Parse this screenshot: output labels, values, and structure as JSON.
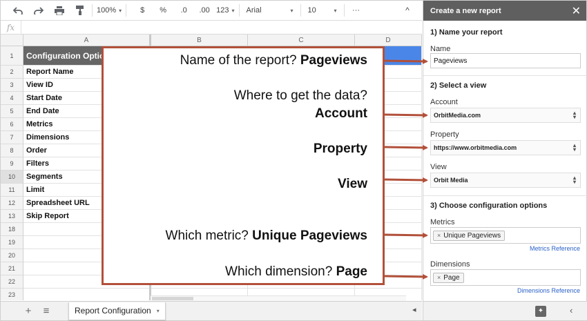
{
  "toolbar": {
    "undo_icon": "undo-icon",
    "redo_icon": "redo-icon",
    "print_icon": "print-icon",
    "paint_format_icon": "paint-format-icon",
    "zoom": "100%",
    "currency": "$",
    "percent": "%",
    "decrease_decimals": ".0",
    "increase_decimals": ".00",
    "more_formats": "123",
    "font": "Arial",
    "font_size": "10",
    "more": "···",
    "collapse": "^"
  },
  "formula_bar": {
    "fx": "fx",
    "value": ""
  },
  "grid": {
    "columns": [
      "A",
      "B",
      "C",
      "D"
    ],
    "rows": [
      {
        "num": "1",
        "a": "Configuration Options"
      },
      {
        "num": "2",
        "a": "Report Name"
      },
      {
        "num": "3",
        "a": "View ID"
      },
      {
        "num": "4",
        "a": "Start Date"
      },
      {
        "num": "5",
        "a": "End Date"
      },
      {
        "num": "6",
        "a": "Metrics"
      },
      {
        "num": "7",
        "a": "Dimensions"
      },
      {
        "num": "8",
        "a": "Order"
      },
      {
        "num": "9",
        "a": "Filters"
      },
      {
        "num": "10",
        "a": "Segments"
      },
      {
        "num": "11",
        "a": "Limit"
      },
      {
        "num": "12",
        "a": "Spreadsheet URL"
      },
      {
        "num": "13",
        "a": "Skip Report"
      },
      {
        "num": "18",
        "a": ""
      },
      {
        "num": "19",
        "a": ""
      },
      {
        "num": "20",
        "a": ""
      },
      {
        "num": "21",
        "a": ""
      },
      {
        "num": "22",
        "a": ""
      },
      {
        "num": "23",
        "a": ""
      }
    ]
  },
  "callout": {
    "l1_q": "Name of the report? ",
    "l1_a": "Pageviews",
    "l2_q": "Where to get the data?",
    "l3_a": "Account",
    "l4_a": "Property",
    "l5_a": "View",
    "l6_q": "Which metric? ",
    "l6_a": "Unique Pageviews",
    "l7_q": "Which dimension? ",
    "l7_a": "Page",
    "border_color": "#b2503a"
  },
  "bottom_bar": {
    "add_sheet": "+",
    "all_sheets": "≡",
    "sheet_tab": "Report Configuration"
  },
  "panel": {
    "title": "Create a new report",
    "close": "✕",
    "s1": "1) Name your report",
    "name_label": "Name",
    "name_value": "Pageviews",
    "s2": "2) Select a view",
    "account_label": "Account",
    "account_value": "OrbitMedia.com",
    "property_label": "Property",
    "property_value": "https://www.orbitmedia.com",
    "view_label": "View",
    "view_value": "Orbit Media",
    "s3": "3) Choose configuration options",
    "metrics_label": "Metrics",
    "metrics_chip": "Unique Pageviews",
    "metrics_ref": "Metrics Reference",
    "dimensions_label": "Dimensions",
    "dimensions_chip": "Page",
    "dimensions_ref": "Dimensions Reference",
    "chip_remove": "×"
  },
  "colors": {
    "accent_red": "#b2503a",
    "panel_header": "#5f5f5f",
    "link_blue": "#2a62c9",
    "selection_blue": "#4a86e8"
  }
}
